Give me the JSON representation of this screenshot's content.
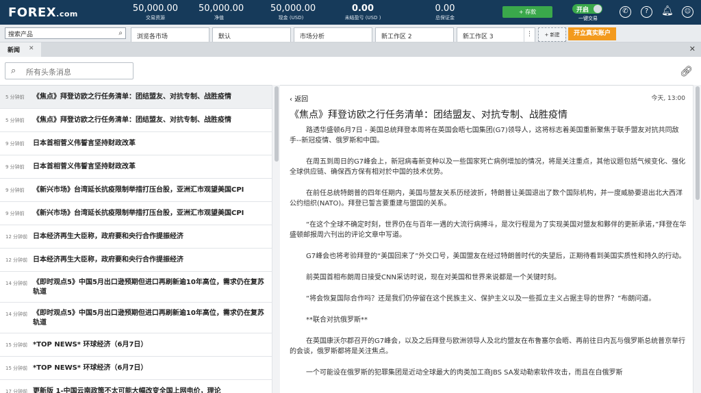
{
  "header": {
    "logo_main": "FOREX",
    "logo_suffix": ".com",
    "metrics": [
      {
        "value": "50,000.00",
        "label": "交易资源"
      },
      {
        "value": "50,000.00",
        "label": "净值"
      },
      {
        "value": "50,000.00",
        "label": "现金 (USD)"
      },
      {
        "value": "0.00",
        "label": "未结盈亏 (USD )"
      },
      {
        "value": "0.00",
        "label": "总保证金"
      }
    ],
    "deposit_label": "+ 存款",
    "toggle_label": "开启",
    "one_click_label": "一键交易",
    "icons": [
      "phone-icon",
      "help-icon",
      "bell-icon",
      "user-icon",
      "settings-icon"
    ]
  },
  "workspace": {
    "search_placeholder": "搜索产品",
    "tabs": [
      "浏览各市场",
      "默认",
      "市场分析",
      "新工作区 2",
      "新工作区 3"
    ],
    "new_label": "+ 新建",
    "open_real_label": "开立真实账户"
  },
  "news_panel": {
    "tab_label": "新闻",
    "search_placeholder": "所有头条消息",
    "items": [
      {
        "time": "5 分钟前",
        "headline": "《焦点》拜登访欧之行任务清单：团结盟友、对抗专制、战胜疫情",
        "selected": true
      },
      {
        "time": "5 分钟前",
        "headline": "《焦点》拜登访欧之行任务清单：团结盟友、对抗专制、战胜疫情",
        "selected": false
      },
      {
        "time": "9 分钟前",
        "headline": "日本首相菅义伟誓言坚持财政改革",
        "selected": false
      },
      {
        "time": "9 分钟前",
        "headline": "日本首相菅义伟誓言坚持财政改革",
        "selected": false
      },
      {
        "time": "9 分钟前",
        "headline": "《新兴市场》台湾延长抗疫限制举措打压台股，亚洲汇市观望美国CPI",
        "selected": false
      },
      {
        "time": "9 分钟前",
        "headline": "《新兴市场》台湾延长抗疫限制举措打压台股，亚洲汇市观望美国CPI",
        "selected": false
      },
      {
        "time": "12 分钟前",
        "headline": "日本经济再生大臣称，政府要和央行合作提振经济",
        "selected": false
      },
      {
        "time": "12 分钟前",
        "headline": "日本经济再生大臣称，政府要和央行合作提振经济",
        "selected": false
      },
      {
        "time": "14 分钟前",
        "headline": "《即时观点5》中国5月出口逊预期但进口再刷新逾10年高位，需求仍在复苏轨道",
        "selected": false
      },
      {
        "time": "14 分钟前",
        "headline": "《即时观点5》中国5月出口逊预期但进口再刷新逾10年高位，需求仍在复苏轨道",
        "selected": false
      },
      {
        "time": "15 分钟前",
        "headline": "*TOP NEWS* 环球经济（6月7日）",
        "selected": false
      },
      {
        "time": "15 分钟前",
        "headline": "*TOP NEWS* 环球经济（6月7日）",
        "selected": false
      },
      {
        "time": "17 分钟前",
        "headline": "更新版 1-中国云南政策不太可能大幅改变全国上网电价，理论",
        "selected": false
      }
    ]
  },
  "article": {
    "back_label": "返回",
    "timestamp": "今天, 13:00",
    "title": "《焦点》拜登访欧之行任务清单：团结盟友、对抗专制、战胜疫情",
    "paragraphs": [
      "路透华盛顿6月7日 - 美国总统拜登本周将在英国会晤七国集团(G7)领导人，这将标志着美国重新聚焦于联手盟友对抗共同敌手--新冠疫情、俄罗斯和中国。",
      "在周五到周日的G7峰会上，新冠病毒新变种以及一些国家死亡病例增加的情况，将是关注重点，其他议题包括气候变化、强化全球供应链、确保西方保有相对於中国的技术优势。",
      "在前任总统特朗普的四年任期内，美国与盟友关系历经波折，特朗普让美国退出了数个国际机构，并一度威胁要退出北大西洋公约组织(NATO)。拜登已誓言要重建与盟国的关系。",
      "“在这个全球不确定时刻，世界仍在与百年一遇的大流行病搏斗，是次行程是为了实现美国对盟友和夥伴的更新承诺，”拜登在华盛顿邮报周六刊出的评论文章中写道。",
      "G7峰会也将考验拜登的“美国回来了”外交口号，美国盟友在经过特朗普时代的失望后，正期待看到美国实质性和持久的行动。",
      "前英国首相布朗周日接受CNN采访时说，现在对美国和世界来说都是一个关键时刻。",
      "“将会恢复国际合作吗？还是我们仍停留在这个民族主义、保护主义以及一些孤立主义占据主导的世界？”布朗问道。",
      "**联合对抗俄罗斯**",
      "在英国康沃尔郡召开的G7峰会，以及之后拜登与欧洲领导人及北约盟友在布鲁塞尔会晤、再前往日内瓦与俄罗斯总统普京举行的会谈，俄罗斯都将是关注焦点。",
      "一个可能设在俄罗斯的犯罪集团是近动全球最大的肉类加工商JBS SA发动勒索软件攻击，而且在白俄罗斯"
    ]
  }
}
